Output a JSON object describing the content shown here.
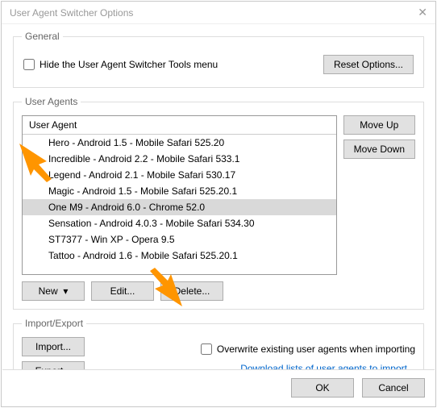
{
  "window": {
    "title": "User Agent Switcher Options"
  },
  "general": {
    "legend": "General",
    "hide_menu_label": "Hide the User Agent Switcher Tools menu",
    "reset_label": "Reset Options..."
  },
  "user_agents": {
    "legend": "User Agents",
    "header": "User Agent",
    "items": [
      {
        "label": "Hero - Android 1.5 - Mobile Safari 525.20",
        "selected": false
      },
      {
        "label": "Incredible - Android 2.2 - Mobile Safari 533.1",
        "selected": false
      },
      {
        "label": "Legend - Android 2.1 - Mobile Safari 530.17",
        "selected": false
      },
      {
        "label": "Magic - Android 1.5 - Mobile Safari 525.20.1",
        "selected": false
      },
      {
        "label": "One M9 - Android 6.0 - Chrome 52.0",
        "selected": true
      },
      {
        "label": "Sensation - Android 4.0.3 - Mobile Safari 534.30",
        "selected": false
      },
      {
        "label": "ST7377 - Win XP - Opera 9.5",
        "selected": false
      },
      {
        "label": "Tattoo - Android 1.6 - Mobile Safari 525.20.1",
        "selected": false
      }
    ],
    "move_up": "Move Up",
    "move_down": "Move Down",
    "new": "New",
    "edit": "Edit...",
    "delete": "Delete..."
  },
  "import_export": {
    "legend": "Import/Export",
    "import": "Import...",
    "export": "Export...",
    "overwrite_label": "Overwrite existing user agents when importing",
    "download_link": "Download lists of user agents to import..."
  },
  "footer": {
    "ok": "OK",
    "cancel": "Cancel"
  }
}
